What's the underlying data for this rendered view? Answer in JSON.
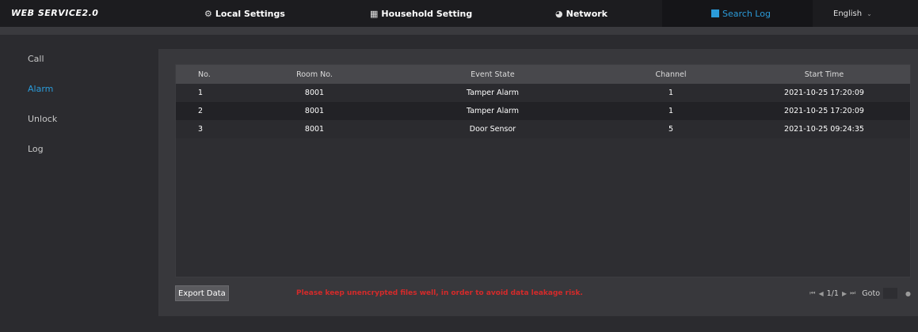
{
  "header": {
    "logo": "WEB SERVICE2.0",
    "nav": [
      {
        "label": "Local Settings",
        "icon": "gear-icon",
        "glyph": "⚙"
      },
      {
        "label": "Household Setting",
        "icon": "building-icon",
        "glyph": "▦"
      },
      {
        "label": "Network",
        "icon": "globe-icon",
        "glyph": "◕"
      },
      {
        "label": "Search Log",
        "icon": "search-log-icon",
        "glyph": ""
      }
    ],
    "language": "English",
    "active_color": "#2b9bd9"
  },
  "sidebar": {
    "items": [
      {
        "label": "Call"
      },
      {
        "label": "Alarm"
      },
      {
        "label": "Unlock"
      },
      {
        "label": "Log"
      }
    ],
    "active_index": 1
  },
  "table": {
    "headers": [
      "No.",
      "Room No.",
      "Event State",
      "Channel",
      "Start Time"
    ],
    "rows": [
      [
        "1",
        "8001",
        "Tamper Alarm",
        "1",
        "2021-10-25 17:20:09"
      ],
      [
        "2",
        "8001",
        "Tamper Alarm",
        "1",
        "2021-10-25 17:20:09"
      ],
      [
        "3",
        "8001",
        "Door Sensor",
        "5",
        "2021-10-25 09:24:35"
      ]
    ]
  },
  "footer": {
    "export_label": "Export Data",
    "warning": "Please keep unencrypted files well, in order to avoid data leakage risk.",
    "warning_color": "#d42a2a",
    "pagination": "1/1",
    "goto_label": "Goto",
    "goto_value": ""
  }
}
